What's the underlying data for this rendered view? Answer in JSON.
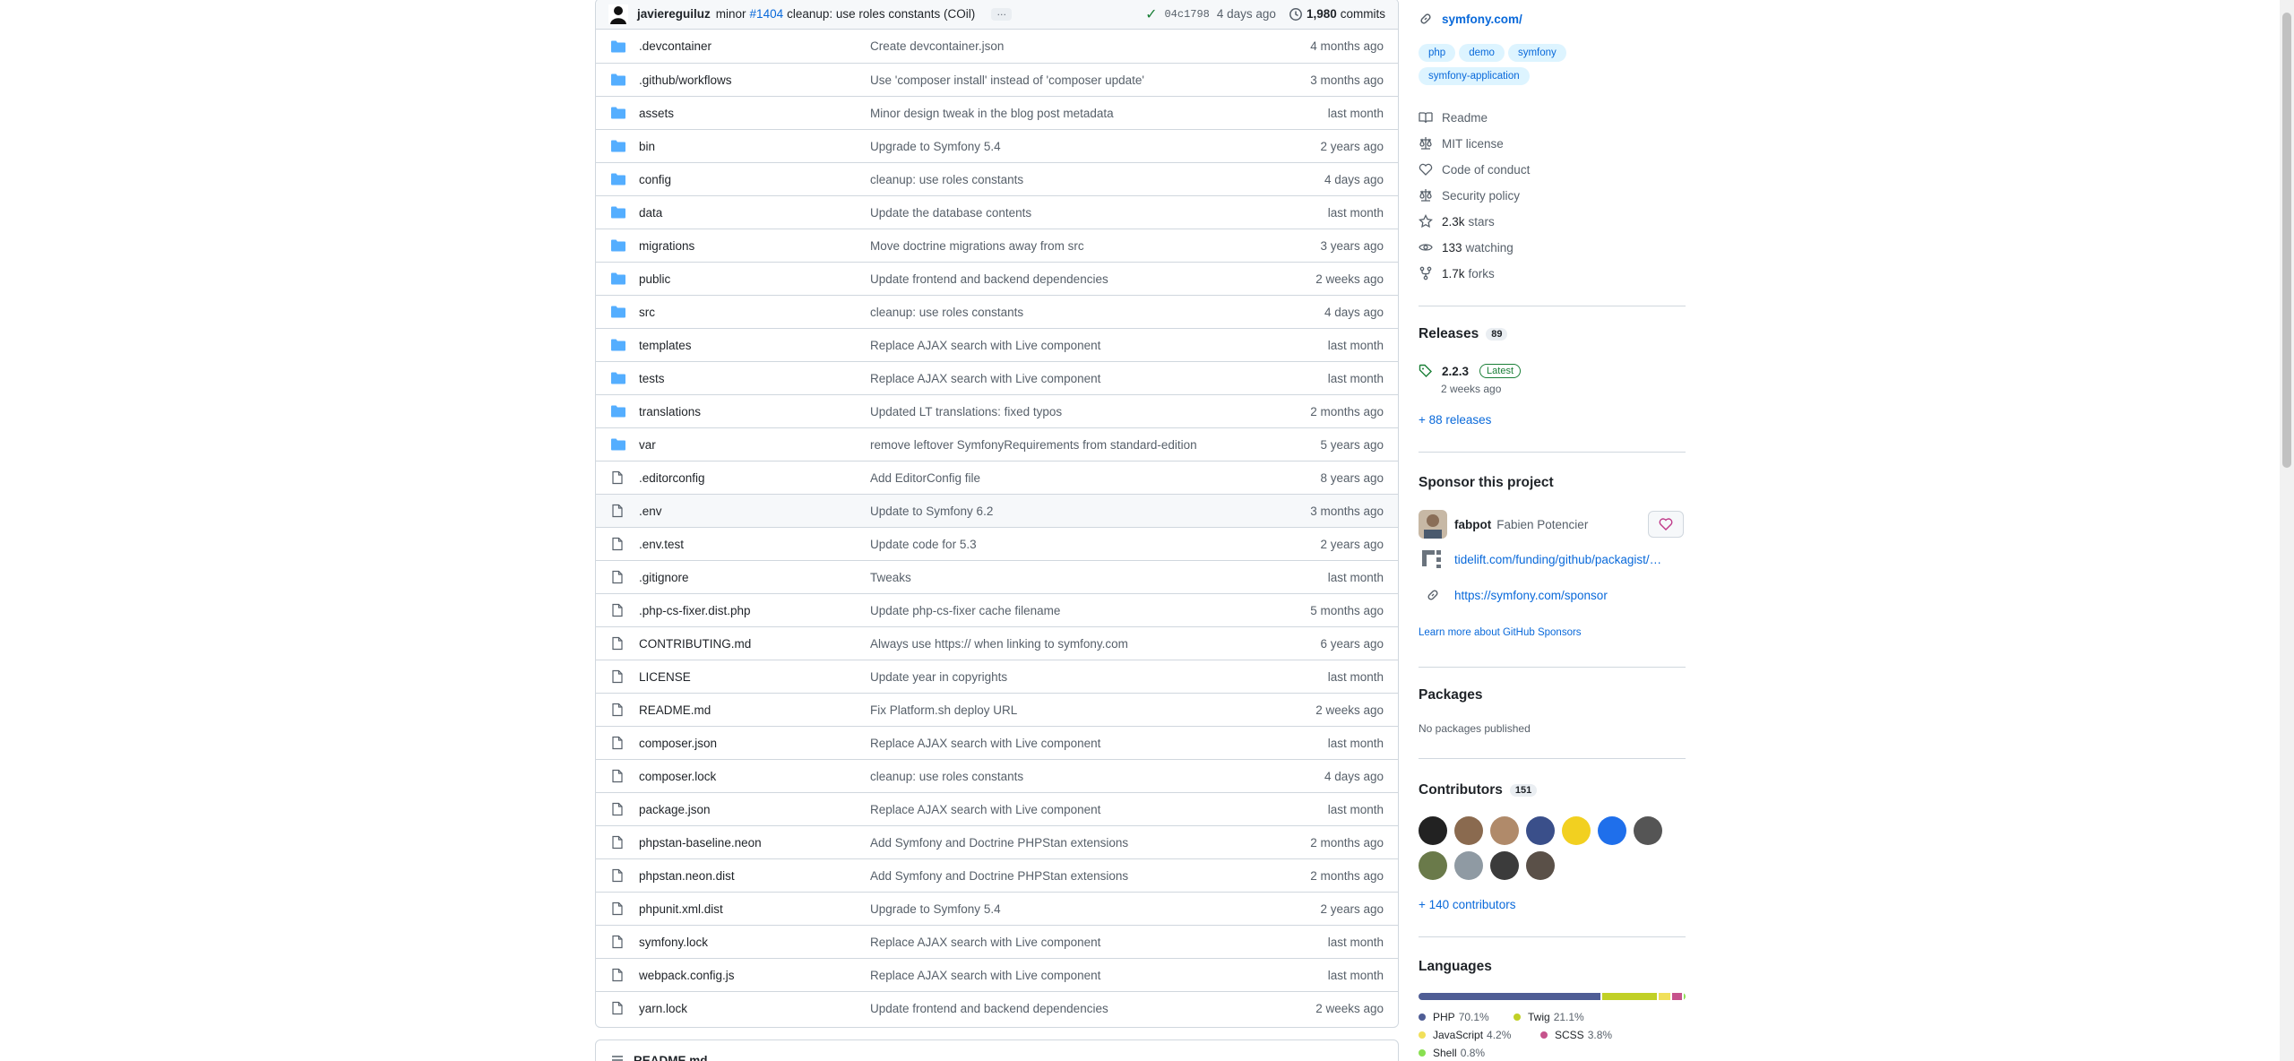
{
  "commit": {
    "author": "javiereguiluz",
    "message_prefix": "minor",
    "issue": "#1404",
    "message": "cleanup: use roles constants (COil)",
    "more": "…",
    "sha": "04c1798",
    "age": "4 days ago",
    "commits_count": "1,980",
    "commits_label": "commits"
  },
  "files": [
    {
      "name": ".devcontainer",
      "type": "folder",
      "message": "Create devcontainer.json",
      "age": "4 months ago"
    },
    {
      "name": ".github/workflows",
      "type": "folder",
      "message": "Use 'composer install' instead of 'composer update'",
      "age": "3 months ago"
    },
    {
      "name": "assets",
      "type": "folder",
      "message": "Minor design tweak in the blog post metadata",
      "age": "last month"
    },
    {
      "name": "bin",
      "type": "folder",
      "message": "Upgrade to Symfony 5.4",
      "age": "2 years ago"
    },
    {
      "name": "config",
      "type": "folder",
      "message": "cleanup: use roles constants",
      "age": "4 days ago"
    },
    {
      "name": "data",
      "type": "folder",
      "message": "Update the database contents",
      "age": "last month"
    },
    {
      "name": "migrations",
      "type": "folder",
      "message": "Move doctrine migrations away from src",
      "age": "3 years ago"
    },
    {
      "name": "public",
      "type": "folder",
      "message": "Update frontend and backend dependencies",
      "age": "2 weeks ago"
    },
    {
      "name": "src",
      "type": "folder",
      "message": "cleanup: use roles constants",
      "age": "4 days ago"
    },
    {
      "name": "templates",
      "type": "folder",
      "message": "Replace AJAX search with Live component",
      "age": "last month"
    },
    {
      "name": "tests",
      "type": "folder",
      "message": "Replace AJAX search with Live component",
      "age": "last month"
    },
    {
      "name": "translations",
      "type": "folder",
      "message": "Updated LT translations: fixed typos",
      "age": "2 months ago"
    },
    {
      "name": "var",
      "type": "folder",
      "message": "remove leftover SymfonyRequirements from standard-edition",
      "age": "5 years ago"
    },
    {
      "name": ".editorconfig",
      "type": "file",
      "message": "Add EditorConfig file",
      "age": "8 years ago"
    },
    {
      "name": ".env",
      "type": "file",
      "message": "Update to Symfony 6.2",
      "age": "3 months ago"
    },
    {
      "name": ".env.test",
      "type": "file",
      "message": "Update code for 5.3",
      "age": "2 years ago"
    },
    {
      "name": ".gitignore",
      "type": "file",
      "message": "Tweaks",
      "age": "last month"
    },
    {
      "name": ".php-cs-fixer.dist.php",
      "type": "file",
      "message": "Update php-cs-fixer cache filename",
      "age": "5 months ago"
    },
    {
      "name": "CONTRIBUTING.md",
      "type": "file",
      "message": "Always use https:// when linking to symfony.com",
      "age": "6 years ago"
    },
    {
      "name": "LICENSE",
      "type": "file",
      "message": "Update year in copyrights",
      "age": "last month"
    },
    {
      "name": "README.md",
      "type": "file",
      "message": "Fix Platform.sh deploy URL",
      "age": "2 weeks ago"
    },
    {
      "name": "composer.json",
      "type": "file",
      "message": "Replace AJAX search with Live component",
      "age": "last month"
    },
    {
      "name": "composer.lock",
      "type": "file",
      "message": "cleanup: use roles constants",
      "age": "4 days ago"
    },
    {
      "name": "package.json",
      "type": "file",
      "message": "Replace AJAX search with Live component",
      "age": "last month"
    },
    {
      "name": "phpstan-baseline.neon",
      "type": "file",
      "message": "Add Symfony and Doctrine PHPStan extensions",
      "age": "2 months ago"
    },
    {
      "name": "phpstan.neon.dist",
      "type": "file",
      "message": "Add Symfony and Doctrine PHPStan extensions",
      "age": "2 months ago"
    },
    {
      "name": "phpunit.xml.dist",
      "type": "file",
      "message": "Upgrade to Symfony 5.4",
      "age": "2 years ago"
    },
    {
      "name": "symfony.lock",
      "type": "file",
      "message": "Replace AJAX search with Live component",
      "age": "last month"
    },
    {
      "name": "webpack.config.js",
      "type": "file",
      "message": "Replace AJAX search with Live component",
      "age": "last month"
    },
    {
      "name": "yarn.lock",
      "type": "file",
      "message": "Update frontend and backend dependencies",
      "age": "2 weeks ago"
    }
  ],
  "readme_header": "README.md",
  "about": {
    "website": "symfony.com/",
    "topics": [
      "php",
      "demo",
      "symfony",
      "symfony-application"
    ],
    "readme": "Readme",
    "license": "MIT license",
    "code_of_conduct": "Code of conduct",
    "security_policy": "Security policy",
    "stars": "2.3k",
    "stars_label": "stars",
    "watching": "133",
    "watching_label": "watching",
    "forks": "1.7k",
    "forks_label": "forks"
  },
  "releases": {
    "title": "Releases",
    "count": "89",
    "latest_version": "2.2.3",
    "latest_badge": "Latest",
    "latest_date": "2 weeks ago",
    "more_link": "+ 88 releases"
  },
  "sponsor": {
    "title": "Sponsor this project",
    "user": "fabpot",
    "user_name": "Fabien Potencier",
    "tidelift": "tidelift.com/funding/github/packagist/…",
    "tidelift_bold": "packagist/…",
    "tidelift_prefix": "tidelift.com/funding/github/",
    "url": "https://symfony.com/sponsor",
    "learn_more": "Learn more about GitHub Sponsors"
  },
  "packages": {
    "title": "Packages",
    "empty": "No packages published"
  },
  "contributors": {
    "title": "Contributors",
    "count": "151",
    "more_link": "+ 140 contributors",
    "avatar_colors": [
      "#222222",
      "#8a6a4f",
      "#b08a6a",
      "#3a4f8a",
      "#f2d020",
      "#1f6feb",
      "#555555",
      "#6a7a4a",
      "#8f9aa3",
      "#3b3b3b",
      "#5a5048"
    ]
  },
  "languages": {
    "title": "Languages",
    "items": [
      {
        "name": "PHP",
        "percent": "70.1%",
        "value": 70.1,
        "color": "#4F5D95"
      },
      {
        "name": "Twig",
        "percent": "21.1%",
        "value": 21.1,
        "color": "#c1d026"
      },
      {
        "name": "JavaScript",
        "percent": "4.2%",
        "value": 4.2,
        "color": "#f1e05a"
      },
      {
        "name": "SCSS",
        "percent": "3.8%",
        "value": 3.8,
        "color": "#c6538c"
      },
      {
        "name": "Shell",
        "percent": "0.8%",
        "value": 0.8,
        "color": "#89e051"
      }
    ]
  }
}
